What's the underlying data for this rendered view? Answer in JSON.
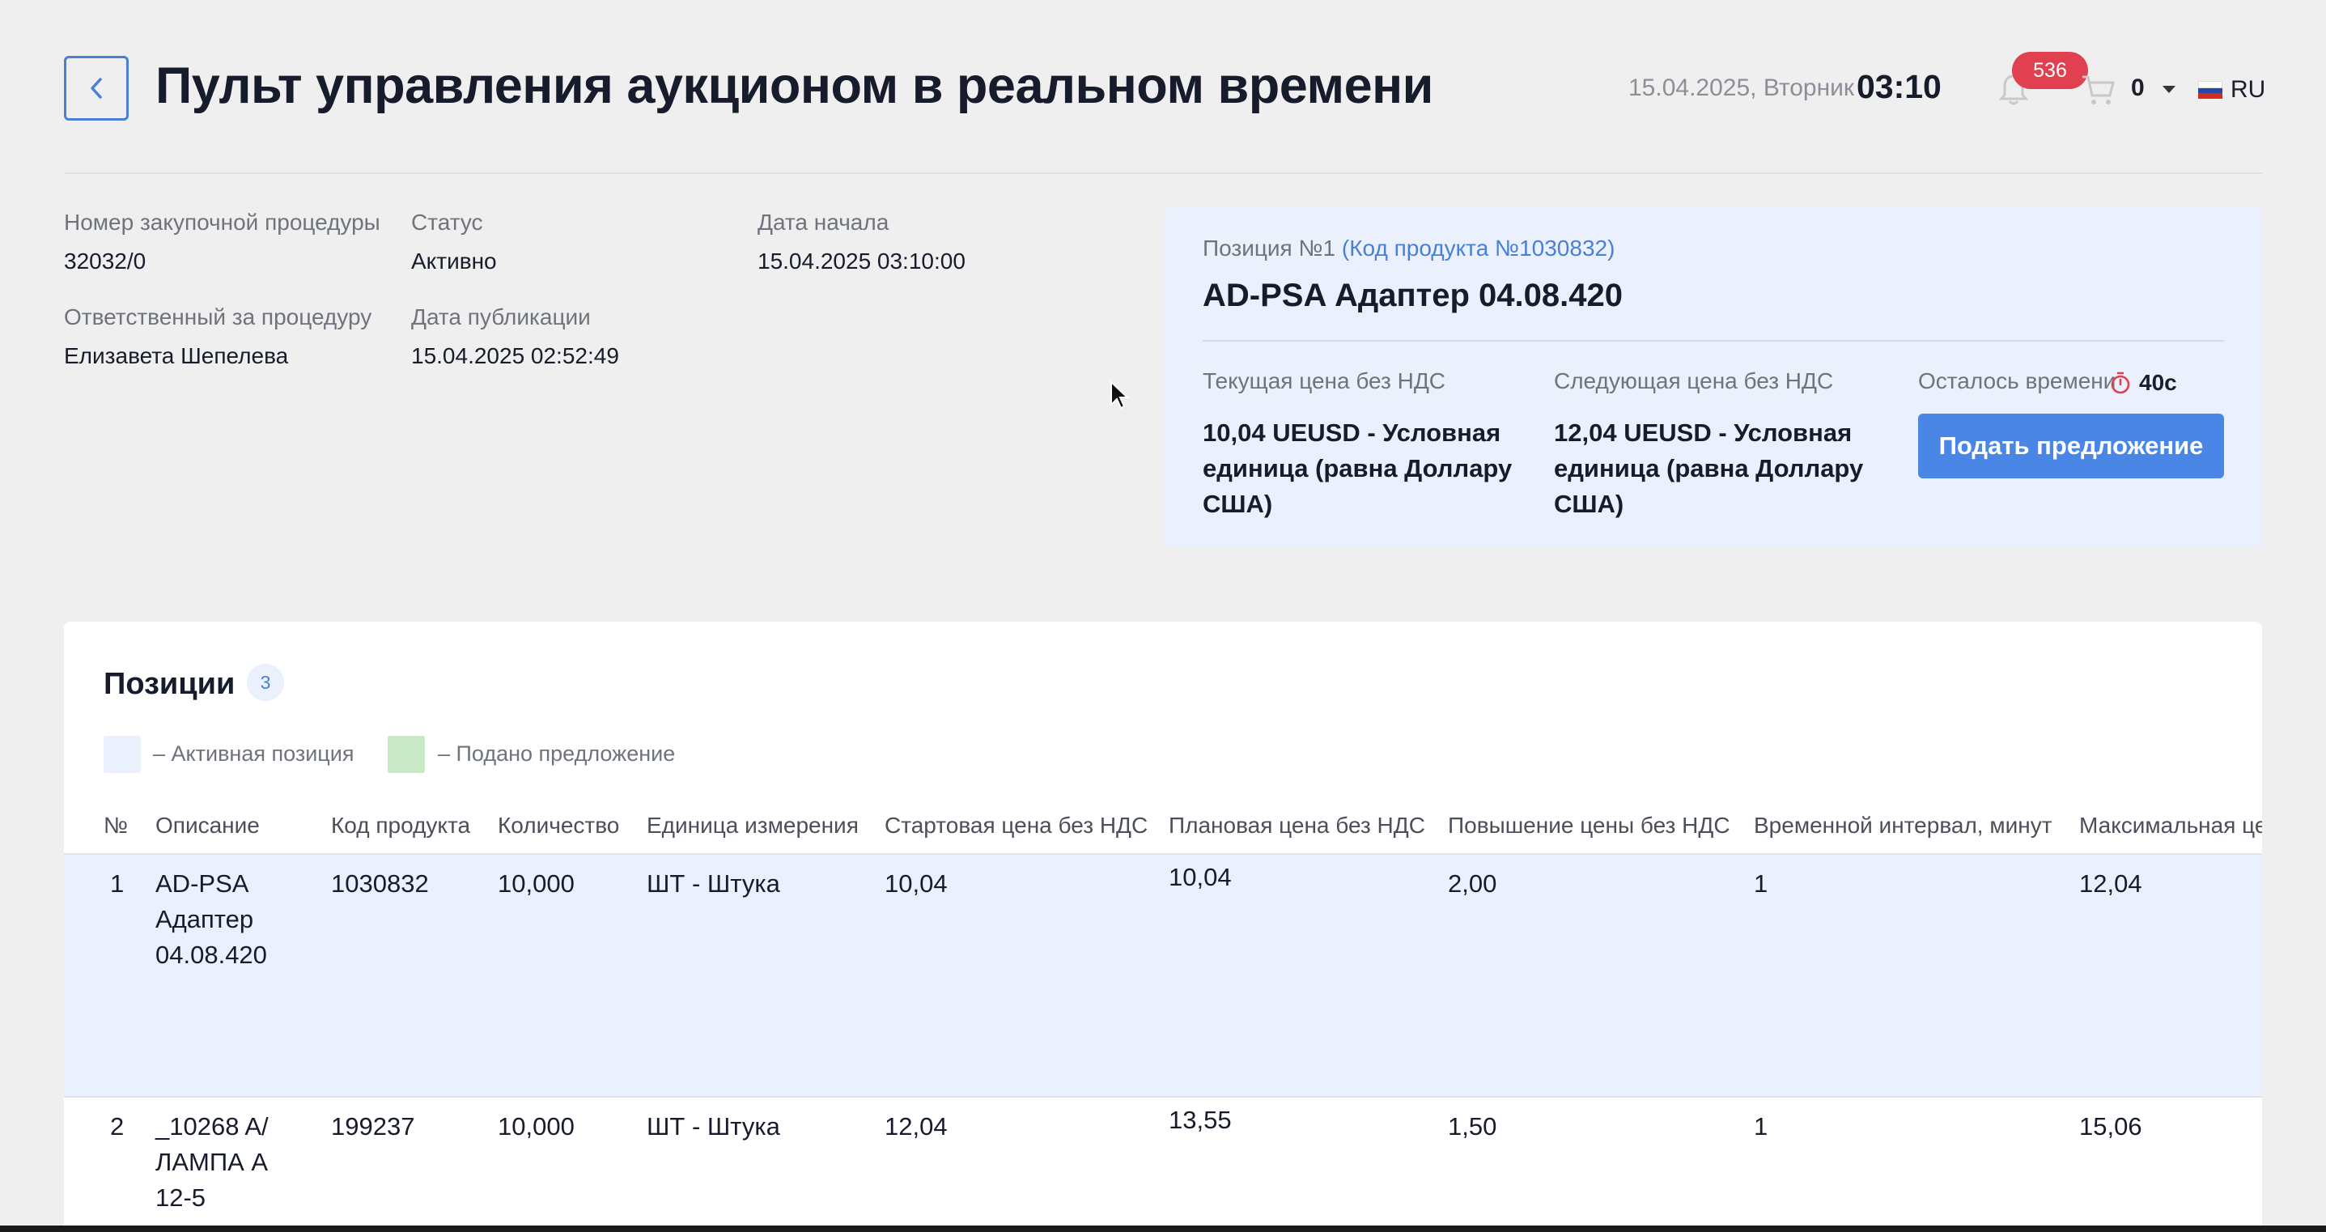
{
  "header": {
    "title": "Пульт управления аукционом в реальном времени",
    "date": "15.04.2025, Вторник",
    "time": "03:10",
    "notifications_count": "536",
    "cart_count": "0",
    "language": "RU"
  },
  "info": {
    "procedure_number_label": "Номер закупочной процедуры",
    "procedure_number": "32032/0",
    "status_label": "Статус",
    "status": "Активно",
    "start_date_label": "Дата начала",
    "start_date": "15.04.2025 03:10:00",
    "responsible_label": "Ответственный за процедуру",
    "responsible": "Елизавета Шепелева",
    "publication_date_label": "Дата публикации",
    "publication_date": "15.04.2025 02:52:49"
  },
  "position_card": {
    "position_label": "Позиция №1",
    "product_code": "(Код продукта №1030832)",
    "title": "AD-PSA Адаптер 04.08.420",
    "current_price_label": "Текущая цена без НДС",
    "current_price": "10,04 UEUSD - Условная единица (равна Доллару США)",
    "next_price_label": "Следующая цена без НДС",
    "next_price": "12,04 UEUSD - Условная единица (равна Доллару США)",
    "time_left_label": "Осталось времени",
    "time_left": "40с",
    "submit_label": "Подать предложение"
  },
  "positions": {
    "title": "Позиции",
    "count": "3",
    "legend_active": "– Активная позиция",
    "legend_submitted": "– Подано предложение",
    "columns": [
      "№",
      "Описание",
      "Код продукта",
      "Количество",
      "Единица измерения",
      "Стартовая цена без НДС",
      "Плановая цена без НДС",
      "Повышение цены без НДС",
      "Временной интервал, минут",
      "Максимальная це"
    ],
    "rows": [
      {
        "n": "1",
        "description": "AD-PSA Адаптер 04.08.420",
        "code": "1030832",
        "qty": "10,000",
        "unit": "ШТ - Штука",
        "start_price": "10,04",
        "plan_price": "10,04",
        "increase": "2,00",
        "interval": "1",
        "max_price": "12,04"
      },
      {
        "n": "2",
        "description": "_10268 A/ ЛАМПА А 12-5",
        "code": "199237",
        "qty": "10,000",
        "unit": "ШТ - Штука",
        "start_price": "12,04",
        "plan_price": "13,55",
        "increase": "1,50",
        "interval": "1",
        "max_price": "15,06"
      }
    ]
  },
  "colors": {
    "accent": "#4a86e6",
    "active_row": "#eaf1fc",
    "submitted": "#c8e8c8",
    "badge": "#e0404f"
  }
}
